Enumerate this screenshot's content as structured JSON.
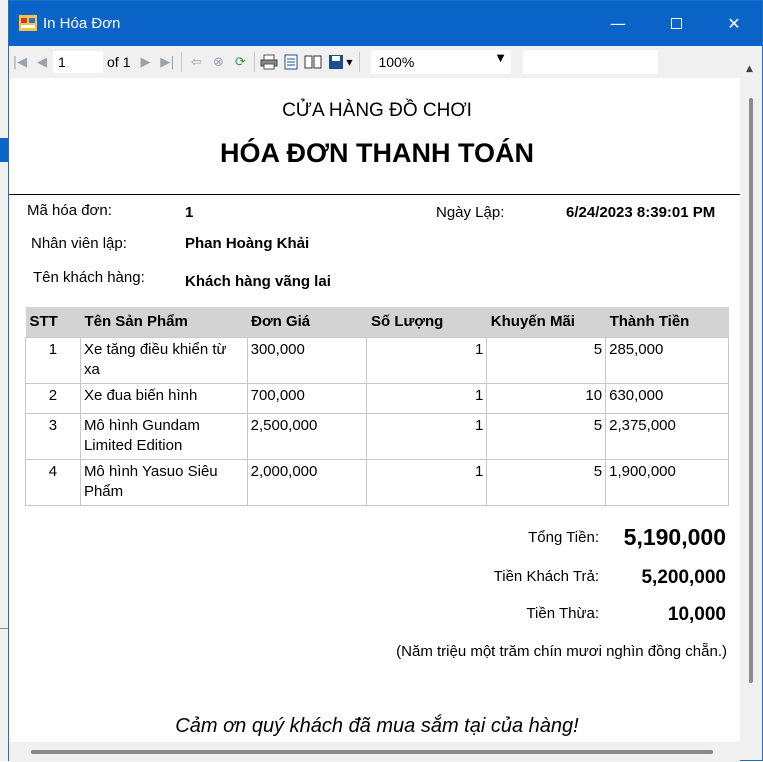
{
  "window": {
    "title": "In Hóa Đơn"
  },
  "toolbar": {
    "current_page": "1",
    "of_label": "of",
    "total_pages": "1",
    "zoom": "100%"
  },
  "report": {
    "shop_name": "CỬA HÀNG ĐỒ CHƠI",
    "title": "HÓA ĐƠN THANH TOÁN",
    "invoice_id_label": "Mã hóa đơn:",
    "invoice_id": "1",
    "date_label": "Ngày Lập:",
    "date": "6/24/2023 8:39:01 PM",
    "employee_label": "Nhân viên lập:",
    "employee": "Phan Hoàng Khải",
    "customer_label": "Tên khách hàng:",
    "customer": "Khách hàng vãng lai",
    "columns": [
      "STT",
      "Tên Sản Phẩm",
      "Đơn Giá",
      "Số Lượng",
      "Khuyến Mãi",
      "Thành Tiền"
    ],
    "rows": [
      {
        "stt": "1",
        "name": "Xe tăng điều khiển từ xa",
        "price": "300,000",
        "qty": "1",
        "discount": "5",
        "total": "285,000"
      },
      {
        "stt": "2",
        "name": "Xe đua biến hình",
        "price": "700,000",
        "qty": "1",
        "discount": "10",
        "total": "630,000"
      },
      {
        "stt": "3",
        "name": "Mô hình Gundam Limited Edition",
        "price": "2,500,000",
        "qty": "1",
        "discount": "5",
        "total": "2,375,000"
      },
      {
        "stt": "4",
        "name": "Mô hình Yasuo Siêu Phẩm",
        "price": "2,000,000",
        "qty": "1",
        "discount": "5",
        "total": "1,900,000"
      }
    ],
    "total_label": "Tổng Tiền:",
    "total": "5,190,000",
    "paid_label": "Tiền Khách Trả:",
    "paid": "5,200,000",
    "change_label": "Tiền Thừa:",
    "change": "10,000",
    "amount_in_words": "(Năm triệu một trăm chín mươi nghìn đồng chẵn.)",
    "thanks": "Cảm ơn quý khách đã mua sắm tại của hàng!"
  },
  "icons": {
    "first": "first-page-icon",
    "prev": "prev-page-icon",
    "next": "next-page-icon",
    "last": "last-page-icon",
    "back": "back-icon",
    "stop": "stop-icon",
    "refresh": "refresh-icon",
    "print": "print-icon",
    "print_layout": "print-layout-icon",
    "page_setup": "page-setup-icon",
    "export": "export-icon"
  },
  "colors": {
    "titlebar": "#0a64c8",
    "table_header": "#d3d3d3"
  }
}
